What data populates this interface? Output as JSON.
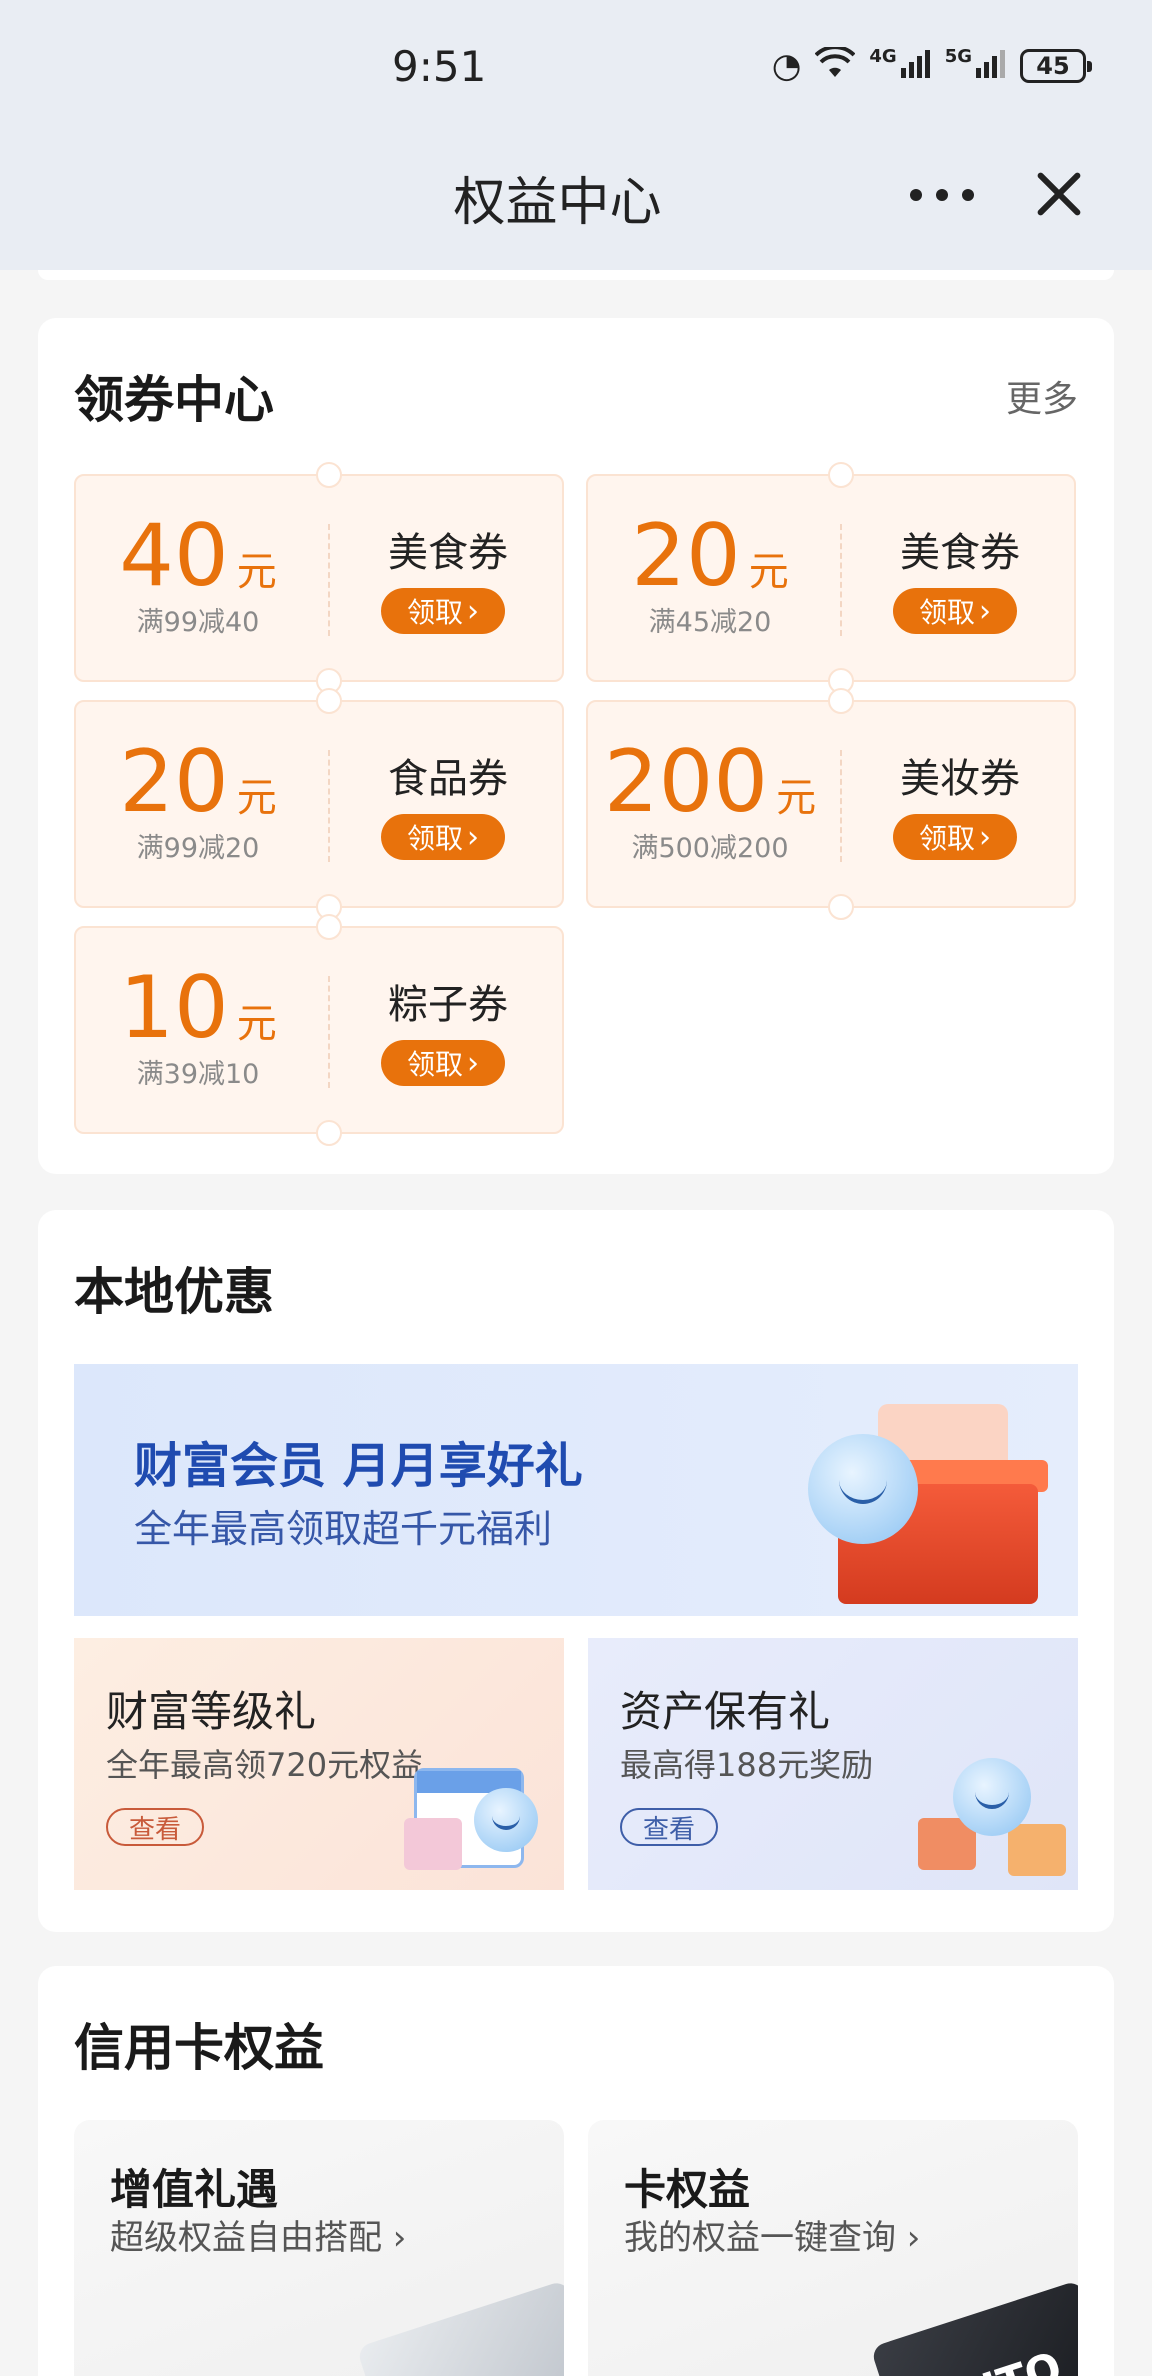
{
  "status_bar": {
    "time": "9:51",
    "network_1": "4G",
    "network_2": "5G",
    "battery": "45"
  },
  "nav": {
    "title": "权益中心"
  },
  "coupon_center": {
    "title": "领券中心",
    "more": "更多",
    "coupons": [
      {
        "amount": "40",
        "unit": "元",
        "rule": "满99减40",
        "type": "美食券",
        "button": "领取"
      },
      {
        "amount": "20",
        "unit": "元",
        "rule": "满45减20",
        "type": "美食券",
        "button": "领取"
      },
      {
        "amount": "20",
        "unit": "元",
        "rule": "满99减20",
        "type": "食品券",
        "button": "领取"
      },
      {
        "amount": "200",
        "unit": "元",
        "rule": "满500减200",
        "type": "美妆券",
        "button": "领取"
      },
      {
        "amount": "10",
        "unit": "元",
        "rule": "满39减10",
        "type": "粽子券",
        "button": "领取"
      }
    ],
    "accent_color": "#e8720c"
  },
  "local_offers": {
    "title": "本地优惠",
    "banner": {
      "title": "财富会员 月月享好礼",
      "subtitle": "全年最高领取超千元福利"
    },
    "tiles": [
      {
        "title": "财富等级礼",
        "subtitle": "全年最高领720元权益",
        "button": "查看"
      },
      {
        "title": "资产保有礼",
        "subtitle": "最高得188元奖励",
        "button": "查看"
      }
    ]
  },
  "credit_card": {
    "title": "信用卡权益",
    "tiles": [
      {
        "title": "增值礼遇",
        "subtitle": "超级权益自由搭配"
      },
      {
        "title": "卡权益",
        "subtitle": "我的权益一键查询"
      }
    ],
    "card_text": "AUTO"
  }
}
